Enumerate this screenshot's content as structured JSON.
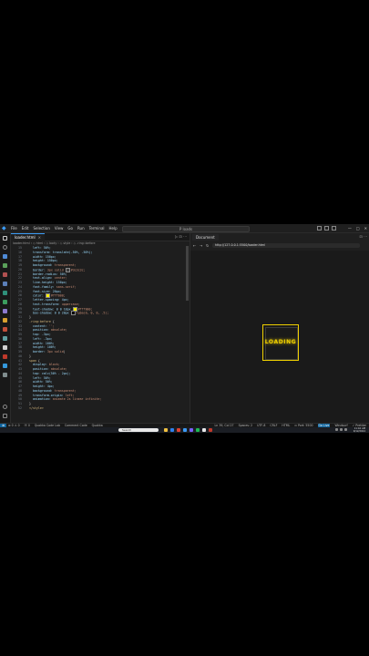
{
  "window": {
    "menu": [
      "File",
      "Edit",
      "Selection",
      "View",
      "Go",
      "Run",
      "Terminal",
      "Help"
    ],
    "search_text": "P loads",
    "controls": [
      "—",
      "□",
      "✕"
    ]
  },
  "editor": {
    "tab_label": "loader.html",
    "tab_close": "×",
    "tab_actions": "▷ ⊡ ⋯",
    "breadcrumb": "loader.html › ◇ html › ◇ body › ◇ style › ◇ .ring::before",
    "lines": [
      {
        "n": "15",
        "indent": "    ",
        "parts": [
          [
            "left: 50%;",
            "prop"
          ]
        ]
      },
      {
        "n": "16",
        "indent": "    ",
        "parts": [
          [
            "transform: translate(-50%, -50%);",
            "prop"
          ]
        ]
      },
      {
        "n": "17",
        "indent": "    ",
        "parts": [
          [
            "width: 150px;",
            "prop"
          ]
        ]
      },
      {
        "n": "18",
        "indent": "    ",
        "parts": [
          [
            "height: 150px;",
            "prop"
          ]
        ]
      },
      {
        "n": "19",
        "indent": "    ",
        "parts": [
          [
            "background: ",
            "prop"
          ],
          [
            "transparent;",
            "val"
          ]
        ]
      },
      {
        "n": "20",
        "indent": "    ",
        "parts": [
          [
            "border: ",
            "prop"
          ],
          [
            "3px solid ",
            "val"
          ],
          [
            "■",
            "swatch:#3c3c3c"
          ],
          [
            "#3c3c3c;",
            "val"
          ]
        ]
      },
      {
        "n": "21",
        "indent": "    ",
        "parts": [
          [
            "border-radius: 50%;",
            "prop"
          ]
        ]
      },
      {
        "n": "22",
        "indent": "    ",
        "parts": [
          [
            "text-align: ",
            "prop"
          ],
          [
            "center;",
            "val"
          ]
        ]
      },
      {
        "n": "23",
        "indent": "    ",
        "parts": [
          [
            "line-height: 150px;",
            "prop"
          ]
        ]
      },
      {
        "n": "24",
        "indent": "    ",
        "parts": [
          [
            "font-family: ",
            "prop"
          ],
          [
            "sans-serif;",
            "val"
          ]
        ]
      },
      {
        "n": "25",
        "indent": "    ",
        "parts": [
          [
            "font-size: 20px;",
            "prop"
          ]
        ]
      },
      {
        "n": "26",
        "indent": "    ",
        "parts": [
          [
            "color: ",
            "prop"
          ],
          [
            "■",
            "swatch:#fff000"
          ],
          [
            "#fff000;",
            "val"
          ]
        ]
      },
      {
        "n": "27",
        "indent": "    ",
        "parts": [
          [
            "letter-spacing: 4px;",
            "prop"
          ]
        ]
      },
      {
        "n": "28",
        "indent": "    ",
        "parts": [
          [
            "text-transform: ",
            "prop"
          ],
          [
            "uppercase;",
            "val"
          ]
        ]
      },
      {
        "n": "29",
        "indent": "    ",
        "parts": [
          [
            "text-shadow: 0 0 10px ",
            "prop"
          ],
          [
            "■",
            "swatch:#fff000"
          ],
          [
            "#fff000;",
            "val"
          ]
        ]
      },
      {
        "n": "30",
        "indent": "    ",
        "parts": [
          [
            "box-shadow: 0 0 20px ",
            "prop"
          ],
          [
            "■",
            "swatch:#000000"
          ],
          [
            "rgba(0, 0, 0, .5);",
            "val"
          ]
        ]
      },
      {
        "n": "31",
        "indent": "  ",
        "parts": [
          [
            "}",
            "pun"
          ]
        ]
      },
      {
        "n": "32",
        "indent": "  ",
        "parts": [
          [
            ".ring:before",
            "sel"
          ],
          [
            " {",
            "pun"
          ]
        ]
      },
      {
        "n": "33",
        "indent": "    ",
        "parts": [
          [
            "content: ",
            "prop"
          ],
          [
            "'';",
            "val"
          ]
        ]
      },
      {
        "n": "34",
        "indent": "    ",
        "parts": [
          [
            "position: ",
            "prop"
          ],
          [
            "absolute;",
            "val"
          ]
        ]
      },
      {
        "n": "35",
        "indent": "    ",
        "parts": [
          [
            "top: -3px;",
            "prop"
          ]
        ]
      },
      {
        "n": "36",
        "indent": "    ",
        "parts": [
          [
            "left: -3px;",
            "prop"
          ]
        ]
      },
      {
        "n": "37",
        "indent": "    ",
        "parts": [
          [
            "width: 100%;",
            "prop"
          ]
        ]
      },
      {
        "n": "38",
        "indent": "    ",
        "parts": [
          [
            "height: 100%;",
            "prop"
          ]
        ]
      },
      {
        "n": "39",
        "indent": "    ",
        "parts": [
          [
            "border: ",
            "prop"
          ],
          [
            "3px solid",
            "val"
          ],
          [
            "|",
            "pun"
          ]
        ]
      },
      {
        "n": "40",
        "indent": "  ",
        "parts": [
          [
            "}",
            "pun"
          ]
        ]
      },
      {
        "n": "41",
        "indent": "  ",
        "parts": [
          [
            "span",
            "sel"
          ],
          [
            " {",
            "pun"
          ]
        ]
      },
      {
        "n": "42",
        "indent": "    ",
        "parts": [
          [
            "display: ",
            "prop"
          ],
          [
            "block;",
            "val"
          ]
        ]
      },
      {
        "n": "43",
        "indent": "    ",
        "parts": [
          [
            "position: ",
            "prop"
          ],
          [
            "absolute;",
            "val"
          ]
        ]
      },
      {
        "n": "44",
        "indent": "    ",
        "parts": [
          [
            "top: calc(50% - 2px);",
            "prop"
          ]
        ]
      },
      {
        "n": "45",
        "indent": "    ",
        "parts": [
          [
            "left: 50%;",
            "prop"
          ]
        ]
      },
      {
        "n": "46",
        "indent": "    ",
        "parts": [
          [
            "width: 50%;",
            "prop"
          ]
        ]
      },
      {
        "n": "47",
        "indent": "    ",
        "parts": [
          [
            "height: 4px;",
            "prop"
          ]
        ]
      },
      {
        "n": "48",
        "indent": "    ",
        "parts": [
          [
            "background: ",
            "prop"
          ],
          [
            "transparent;",
            "val"
          ]
        ]
      },
      {
        "n": "49",
        "indent": "    ",
        "parts": [
          [
            "transform-origin: ",
            "prop"
          ],
          [
            "left;",
            "val"
          ]
        ]
      },
      {
        "n": "50",
        "indent": "    ",
        "parts": [
          [
            "animation: ",
            "prop"
          ],
          [
            "animate 2s linear infinite;",
            "val"
          ]
        ]
      },
      {
        "n": "51",
        "indent": "  ",
        "parts": [
          [
            "}",
            "pun"
          ]
        ]
      },
      {
        "n": "52",
        "indent": "  ",
        "parts": [
          [
            "</style>",
            "sel"
          ]
        ]
      }
    ]
  },
  "browser": {
    "tab_label": "Document",
    "tab_actions": "⊡ ⋯",
    "url": "http://127.0.0.1:5500/loader.html",
    "nav": [
      "←",
      "→",
      "↻"
    ],
    "loader_text": "LOADING",
    "colors": {
      "loader": "#f0d000"
    }
  },
  "statusbar": {
    "remote": "⌘",
    "left": [
      "⊗ 0 ⚠ 0",
      "ⓦ 0",
      "Quokka Code Lab",
      "Comment Code",
      "Quokka"
    ],
    "right": [
      "Ln 39, Col 27",
      "Spaces: 2",
      "UTF-8",
      "CRLF",
      "HTML",
      "⊙ Port: 5500",
      "Go Live",
      "Windsurf",
      "✓ Prettier"
    ]
  },
  "taskbar": {
    "search_placeholder": "Search",
    "time": "11:42 AM",
    "date": "9/12/2024"
  }
}
